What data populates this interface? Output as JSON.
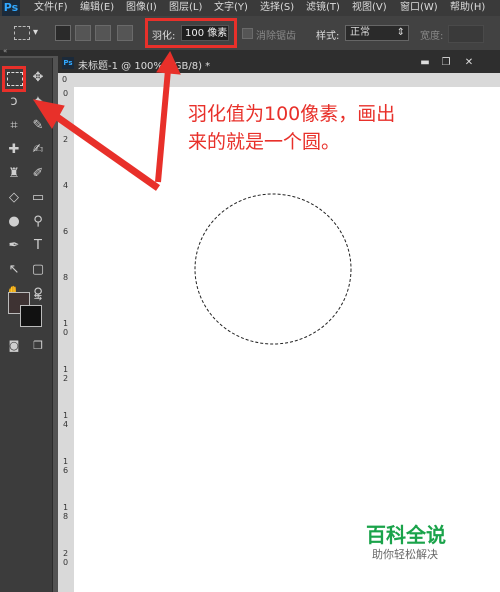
{
  "app": {
    "logo": "Ps"
  },
  "menu": [
    "文件(F)",
    "编辑(E)",
    "图像(I)",
    "图层(L)",
    "文字(Y)",
    "选择(S)",
    "滤镜(T)",
    "视图(V)",
    "窗口(W)",
    "帮助(H)"
  ],
  "options": {
    "feather_label": "羽化:",
    "feather_value": "100 像素",
    "antialias_label": "消除锯齿",
    "style_label": "样式:",
    "style_value": "正常",
    "width_label": "宽度:"
  },
  "document": {
    "title": "未标题-1 @ 100%(RGB/8) *",
    "minimize": "▬",
    "restore": "❐",
    "close": "✕"
  },
  "ruler": {
    "top": [
      "0"
    ],
    "left": [
      "0",
      "2",
      "4",
      "6",
      "8",
      "1",
      "0",
      "1",
      "2",
      "1",
      "4",
      "1",
      "6",
      "1",
      "8",
      "2",
      "0"
    ]
  },
  "annotation": {
    "line1": "羽化值为100像素，画出",
    "line2": "来的就是一个圆。"
  },
  "watermark": {
    "title": "百科全说",
    "subtitle": "助你轻松解决"
  },
  "colors": {
    "highlight": "#e8302a",
    "brand_green": "#1aa34a"
  }
}
